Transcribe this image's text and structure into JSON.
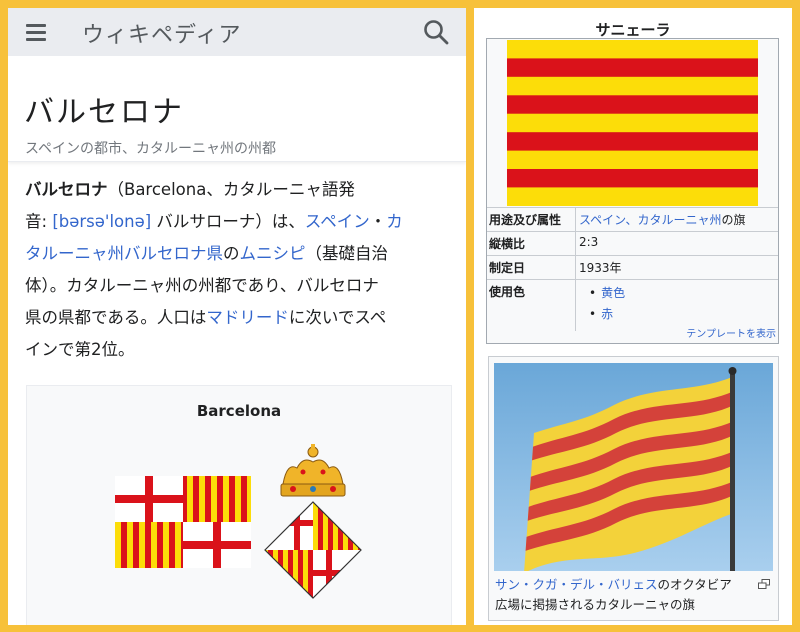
{
  "header": {
    "site_title": "ウィキペディア",
    "menu_icon": "hamburger-menu-icon",
    "search_icon": "search-icon"
  },
  "article": {
    "title": "バルセロナ",
    "subtitle": "スペインの都市、カタルーニャ州の州都",
    "lead": {
      "bold_name": "バルセロナ",
      "t1": "（Barcelona、カタルーニャ語発",
      "t2": "音: ",
      "ipa": "[bərsə'lonə]",
      "t3": " バルサローナ）は、",
      "link_spain": "スペイン",
      "t4": "・",
      "link_cat1": "カ",
      "link_cat2": "タルーニャ州",
      "link_province": "バルセロナ県",
      "t5": "の",
      "link_municipality": "ムニシピ",
      "t6": "（基礎自治",
      "t7": "体）。カタルーニャ州の州都であり、バルセロナ",
      "t8": "県の県都である。人口は",
      "link_madrid": "マドリード",
      "t9": "に次いでスペ",
      "t10": "インで第2位。"
    },
    "infobox_caption": "Barcelona"
  },
  "senyera_infobox": {
    "title": "サニェーラ",
    "rows": [
      {
        "key": "用途及び属性",
        "link": "スペイン、カタルーニャ州",
        "suffix": "の旗"
      },
      {
        "key": "縦横比",
        "value": "2:3"
      },
      {
        "key": "制定日",
        "value": "1933年"
      },
      {
        "key": "使用色",
        "items": [
          "黄色",
          "赤"
        ]
      }
    ],
    "template_link": "テンプレートを表示"
  },
  "photo": {
    "caption_link": "サン・クガ・デル・バリェス",
    "caption_text1": "のオクタビア",
    "caption_text2": "広場に掲揚されるカタルーニャの旗"
  },
  "colors": {
    "frame": "#f7c13a",
    "link": "#3366cc",
    "flag_yellow": "#fcdd09",
    "flag_red": "#da121a",
    "header_bg": "#eaecf0"
  }
}
